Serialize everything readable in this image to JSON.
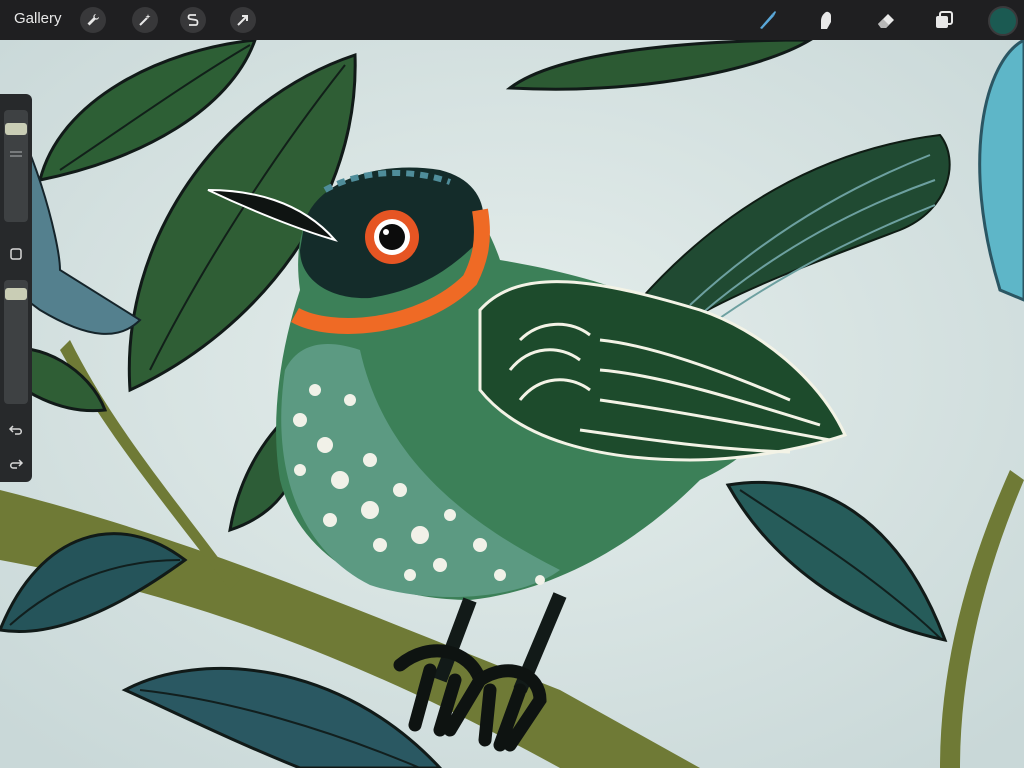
{
  "toolbar": {
    "gallery_label": "Gallery",
    "left_tools": [
      {
        "name": "actions",
        "icon": "wrench-icon"
      },
      {
        "name": "adjustments",
        "icon": "magic-wand-icon"
      },
      {
        "name": "selection",
        "icon": "selection-s-icon"
      },
      {
        "name": "transform",
        "icon": "arrow-cursor-icon"
      }
    ],
    "right_tools": [
      {
        "name": "brush",
        "icon": "brush-icon"
      },
      {
        "name": "smudge",
        "icon": "smudge-finger-icon"
      },
      {
        "name": "eraser",
        "icon": "eraser-icon"
      },
      {
        "name": "layers",
        "icon": "layers-icon"
      }
    ],
    "current_color": "#1b5a52",
    "active_tool": "brush",
    "active_color": "#5aa7d8"
  },
  "sidebar": {
    "brush_size_level": 0.12,
    "opacity_level": 0.06,
    "modify_button_icon": "square-icon",
    "undo_icon": "undo-icon",
    "redo_icon": "redo-icon"
  }
}
